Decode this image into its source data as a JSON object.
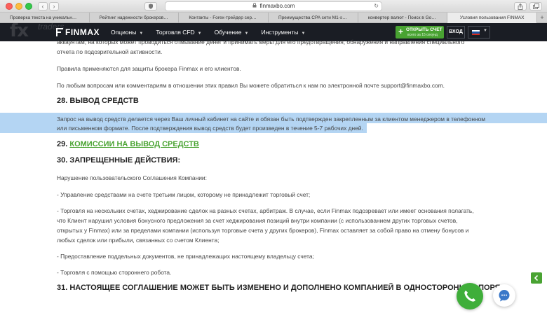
{
  "browser": {
    "url": "finmaxbo.com",
    "nav": {
      "back": "‹",
      "forward": "›"
    },
    "tabs": [
      "Проверка текста на уникальность...",
      "Рейтинг надежности брокеров би...",
      "Контакты - Forex-трейдер сервис",
      "Преимущества CPA сети M1-shop...",
      "конвертер валют - Поиск в Google",
      "Условия пользования FINMAX"
    ],
    "active_tab_index": 5
  },
  "header": {
    "watermark": "fx",
    "watermark_sub": "traders",
    "logo": "FINMAX",
    "menu": [
      "Опционы",
      "Торговля CFD",
      "Обучение",
      "Инструменты"
    ],
    "open_account_label": "ОТКРЫТЬ СЧЕТ",
    "open_account_sub": "всего за 15 секунд",
    "login_label": "ВХОД",
    "flag_colors": [
      "#ffffff",
      "#1c57a5",
      "#d52b1e"
    ]
  },
  "content": {
    "p_top_1": "аккаунтам, на которых может проводиться отмывание денег и принимать меры для его предотвращения, обнаружения и направления специального",
    "p_top_2": "отчета по подозрительной активности.",
    "p_rules": "Правила применяются для защиты брокера Finmax и его клиентов.",
    "p_contact": "По любым вопросам или комментариям в отношении этих правил Вы можете обратиться к нам по электронной почте support@finmaxbo.com.",
    "h28": "28. ВЫВОД СРЕДСТВ",
    "p28_1": "Запрос на вывод средств делается через Ваш личный кабинет на сайте и обязан быть подтвержден закрепленным за клиентом менеджером в телефонном",
    "p28_2": "или письменном формате. После подтверждения вывод средств будет произведен в течение 5-7 рабочих дней.",
    "h29_num": "29.",
    "h29_link": "КОМИССИИ НА ВЫВОД СРЕДСТВ",
    "h30": "30. ЗАПРЕЩЕННЫЕ ДЕЙСТВИЯ:",
    "p30_intro": "Нарушение пользовательского Соглашения Компании:",
    "p30_a": "- Управление средствами на счете третьим лицом, которому не принадлежит торговый счет;",
    "p30_b1": "- Торговля на нескольких счетах, хеджирование сделок на разных счетах, арбитраж. В случае, если Finmax подозревает или имеет основания полагать,",
    "p30_b2": "что Клиент нарушил условия бонусного предложения за счет хеджирования позиций внутри компании (с использованием других торговых счетов,",
    "p30_b3": "открытых у Finmax) или за пределами компании (используя торговые счета у других брокеров), Finmax оставляет за собой право на отмену бонусов и",
    "p30_b4": "любых сделок или прибыли, связанных со счетом Клиента;",
    "p30_c": "- Предоставление поддельных документов, не принадлежащих настоящему владельцу счета;",
    "p30_d": "- Торговля с помощью стороннего робота.",
    "h31": "31. НАСТОЯЩЕЕ СОГЛАШЕНИЕ МОЖЕТ БЫТЬ ИЗМЕНЕНО И ДОПОЛНЕНО КОМПАНИЕЙ В ОДНОСТОРОННЕМ ПОРЯ"
  },
  "colors": {
    "accent_green": "#49a332",
    "header_dark": "#1a1d24",
    "selection": "#b4d5f3"
  }
}
